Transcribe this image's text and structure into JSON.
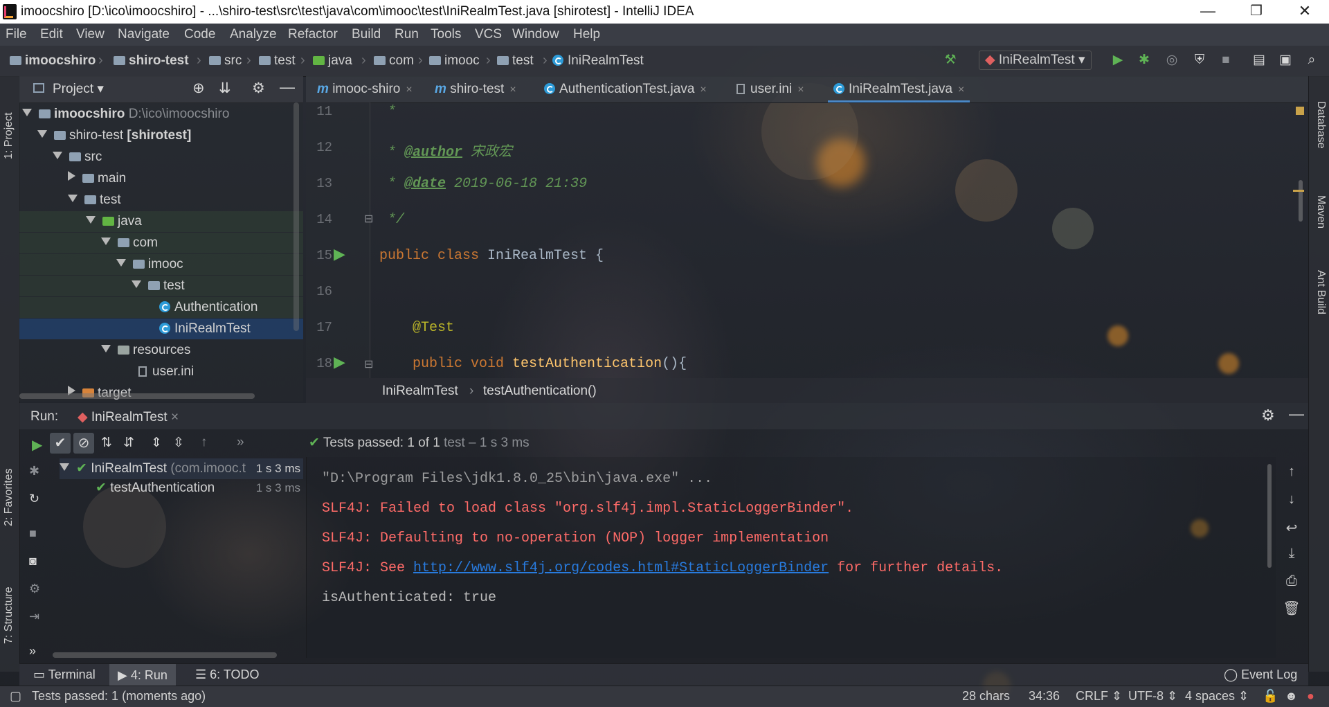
{
  "window": {
    "title": "imoocshiro [D:\\ico\\imoocshiro] - ...\\shiro-test\\src\\test\\java\\com\\imooc\\test\\IniRealmTest.java [shirotest] - IntelliJ IDEA",
    "minimize": "—",
    "restore": "❐",
    "close": "✕"
  },
  "menu": [
    "File",
    "Edit",
    "View",
    "Navigate",
    "Code",
    "Analyze",
    "Refactor",
    "Build",
    "Run",
    "Tools",
    "VCS",
    "Window",
    "Help"
  ],
  "breadcrumb": {
    "items": [
      "imoocshiro",
      "shiro-test",
      "src",
      "test",
      "java",
      "com",
      "imooc",
      "test",
      "IniRealmTest"
    ],
    "run_config": "IniRealmTest"
  },
  "left_stripe": {
    "project": "1: Project",
    "favorites": "2: Favorites",
    "structure": "7: Structure"
  },
  "right_stripe": {
    "database": "Database",
    "maven": "Maven",
    "ant": "Ant Build"
  },
  "project_panel": {
    "title": "Project",
    "tree": [
      {
        "label": "imoocshiro",
        "extra": "D:\\ico\\imoocshiro"
      },
      {
        "label": "shiro-test",
        "extra": "[shirotest]"
      },
      {
        "label": "src"
      },
      {
        "label": "main"
      },
      {
        "label": "test"
      },
      {
        "label": "java"
      },
      {
        "label": "com"
      },
      {
        "label": "imooc"
      },
      {
        "label": "test"
      },
      {
        "label": "Authentication"
      },
      {
        "label": "IniRealmTest"
      },
      {
        "label": "resources"
      },
      {
        "label": "user.ini"
      },
      {
        "label": "target"
      }
    ]
  },
  "editor": {
    "tabs": [
      {
        "icon": "m",
        "label": "imooc-shiro"
      },
      {
        "icon": "m",
        "label": "shiro-test"
      },
      {
        "icon": "class",
        "label": "AuthenticationTest.java"
      },
      {
        "icon": "file",
        "label": "user.ini"
      },
      {
        "icon": "class",
        "label": "IniRealmTest.java"
      }
    ],
    "close_glyph": "×",
    "line_numbers": [
      "11",
      "12",
      "13",
      "14",
      "15",
      "16",
      "17",
      "18"
    ],
    "code": {
      "l11": " *",
      "l12_star": " * ",
      "l12_tag": "@author",
      "l12_text": " 宋政宏",
      "l13_star": " * ",
      "l13_tag": "@date",
      "l13_text": " 2019-06-18 21:39",
      "l14": " */",
      "l15_kw": "public class ",
      "l15_name": "IniRealmTest {",
      "l17": "@Test",
      "l18_kw": "public void ",
      "l18_fn": "testAuthentication",
      "l18_rest": "(){"
    },
    "breadcrumb": [
      "IniRealmTest",
      "testAuthentication()"
    ]
  },
  "run": {
    "label": "Run:",
    "config": "IniRealmTest",
    "status": "Tests passed: ",
    "status_count": "1 of 1",
    "status_rest": " test – 1 s 3 ms",
    "tree": [
      {
        "label": "IniRealmTest",
        "extra": "(com.imooc.t",
        "time": "1 s 3 ms"
      },
      {
        "label": "testAuthentication",
        "time": "1 s 3 ms"
      }
    ],
    "console": {
      "l1": "\"D:\\Program Files\\jdk1.8.0_25\\bin\\java.exe\" ...",
      "l2": "SLF4J: Failed to load class \"org.slf4j.impl.StaticLoggerBinder\".",
      "l3": "SLF4J: Defaulting to no-operation (NOP) logger implementation",
      "l4a": "SLF4J: See ",
      "l4link": "http://www.slf4j.org/codes.html#StaticLoggerBinder",
      "l4b": " for further details.",
      "l5": "isAuthenticated: true"
    }
  },
  "bottom_tabs": [
    {
      "label": "Terminal"
    },
    {
      "label": "4: Run"
    },
    {
      "label": "6: TODO"
    }
  ],
  "event_log": "Event Log",
  "status_bar": {
    "message": "Tests passed: 1 (moments ago)",
    "chars": "28 chars",
    "position": "34:36",
    "line_sep": "CRLF",
    "encoding": "UTF-8",
    "indent": "4 spaces"
  },
  "colors": {
    "accent": "#4a88c7",
    "pass": "#5fb355",
    "error": "#ff6b68",
    "link": "#287bde"
  }
}
